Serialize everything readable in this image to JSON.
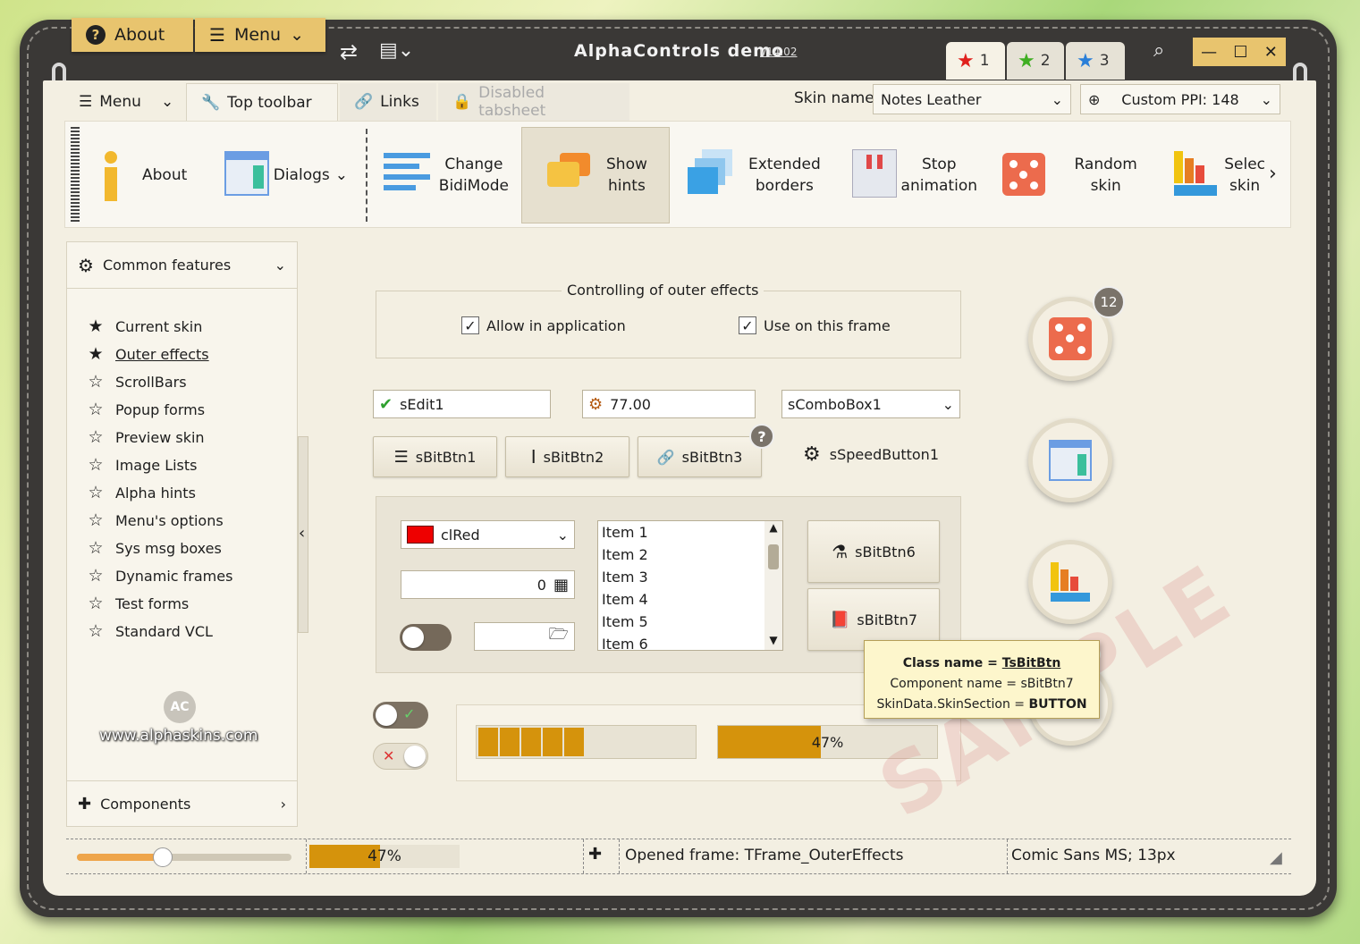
{
  "title": {
    "app": "AlphaControls demo",
    "version": "v14.02"
  },
  "top_tabs": {
    "about": "About",
    "menu": "Menu"
  },
  "skin_tabs": [
    "1",
    "2",
    "3"
  ],
  "page_tabs": {
    "menu": "Menu",
    "top_toolbar": "Top toolbar",
    "links": "Links",
    "disabled": "Disabled tabsheet"
  },
  "skin_name": {
    "label": "Skin name:",
    "value": "Notes Leather"
  },
  "ppi": {
    "label": "Custom PPI: 148"
  },
  "toolbar": {
    "about": "About",
    "dialogs": "Dialogs",
    "change1": "Change",
    "change2": "BidiMode",
    "hints1": "Show",
    "hints2": "hints",
    "ext1": "Extended",
    "ext2": "borders",
    "stop1": "Stop",
    "stop2": "animation",
    "random": "Random skin",
    "sel1": "Selec",
    "sel2": "skin"
  },
  "sidebar": {
    "header": "Common features",
    "items": [
      "Current skin",
      "Outer effects",
      "ScrollBars",
      "Popup forms",
      "Preview skin",
      "Image Lists",
      "Alpha hints",
      "Menu's options",
      "Sys msg boxes",
      "Dynamic frames",
      "Test forms",
      "Standard VCL"
    ],
    "logo_url": "www.alphaskins.com",
    "footer": "Components"
  },
  "outer": {
    "title": "Controlling of outer effects",
    "allow": "Allow in application",
    "use": "Use on this frame"
  },
  "edits": {
    "edit1": "sEdit1",
    "num": "77.00",
    "combo": "sComboBox1"
  },
  "buttons": {
    "b1": "sBitBtn1",
    "b2": "sBitBtn2",
    "b3": "sBitBtn3",
    "speed": "sSpeedButton1",
    "b6": "sBitBtn6",
    "b7": "sBitBtn7"
  },
  "color_combo": {
    "value": "clRed",
    "color": "#ee0000"
  },
  "spin": {
    "value": "0"
  },
  "list_items": [
    "Item 1",
    "Item 2",
    "Item 3",
    "Item 4",
    "Item 5",
    "Item 6"
  ],
  "badge": "12",
  "progress": {
    "segmented": 0.5,
    "value": 0.47,
    "label": "47%"
  },
  "tooltip": {
    "l1_key": "Class name = ",
    "l1_val": "TsBitBtn",
    "l2": "Component name = sBitBtn7",
    "l3_key": "SkinData.SkinSection = ",
    "l3_val": "BUTTON"
  },
  "watermark": "SAMPLE",
  "status": {
    "slider": 0.4,
    "progress_label": "47%",
    "progress": 0.47,
    "frame": "Opened frame: TFrame_OuterEffects",
    "font": "Comic Sans MS; 13px"
  },
  "colors": {
    "accent": "#e8c46e",
    "progress": "#d5930c",
    "background": "#f3efe2"
  }
}
